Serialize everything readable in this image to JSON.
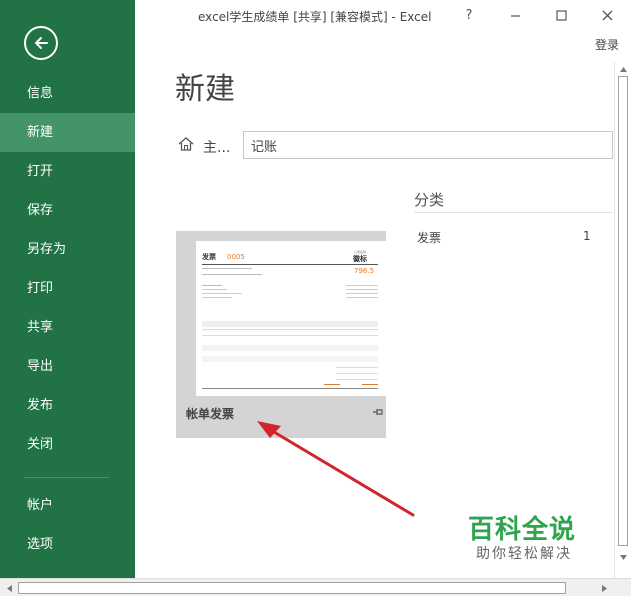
{
  "window": {
    "title": "excel学生成绩单  [共享]  [兼容模式] - Excel",
    "help": "?",
    "login": "登录"
  },
  "sidebar": {
    "items": [
      {
        "label": "信息"
      },
      {
        "label": "新建",
        "active": true
      },
      {
        "label": "打开"
      },
      {
        "label": "保存"
      },
      {
        "label": "另存为"
      },
      {
        "label": "打印"
      },
      {
        "label": "共享"
      },
      {
        "label": "导出"
      },
      {
        "label": "发布"
      },
      {
        "label": "关闭"
      },
      {
        "label": "帐户"
      },
      {
        "label": "选项"
      }
    ],
    "colors": {
      "background": "#217346",
      "active": "#439467"
    }
  },
  "main": {
    "title": "新建",
    "home_label": "主...",
    "search_value": "记账"
  },
  "categories": {
    "title": "分类",
    "items": [
      {
        "name": "发票",
        "count": "1"
      }
    ]
  },
  "template": {
    "name": "帐单发票",
    "thumb": {
      "title": "发票",
      "number": "0005",
      "logo_small": "公司名称",
      "logo": "徽标",
      "amount": "796.5"
    }
  },
  "watermark": {
    "main": "百科全说",
    "sub": "助你轻松解决"
  }
}
